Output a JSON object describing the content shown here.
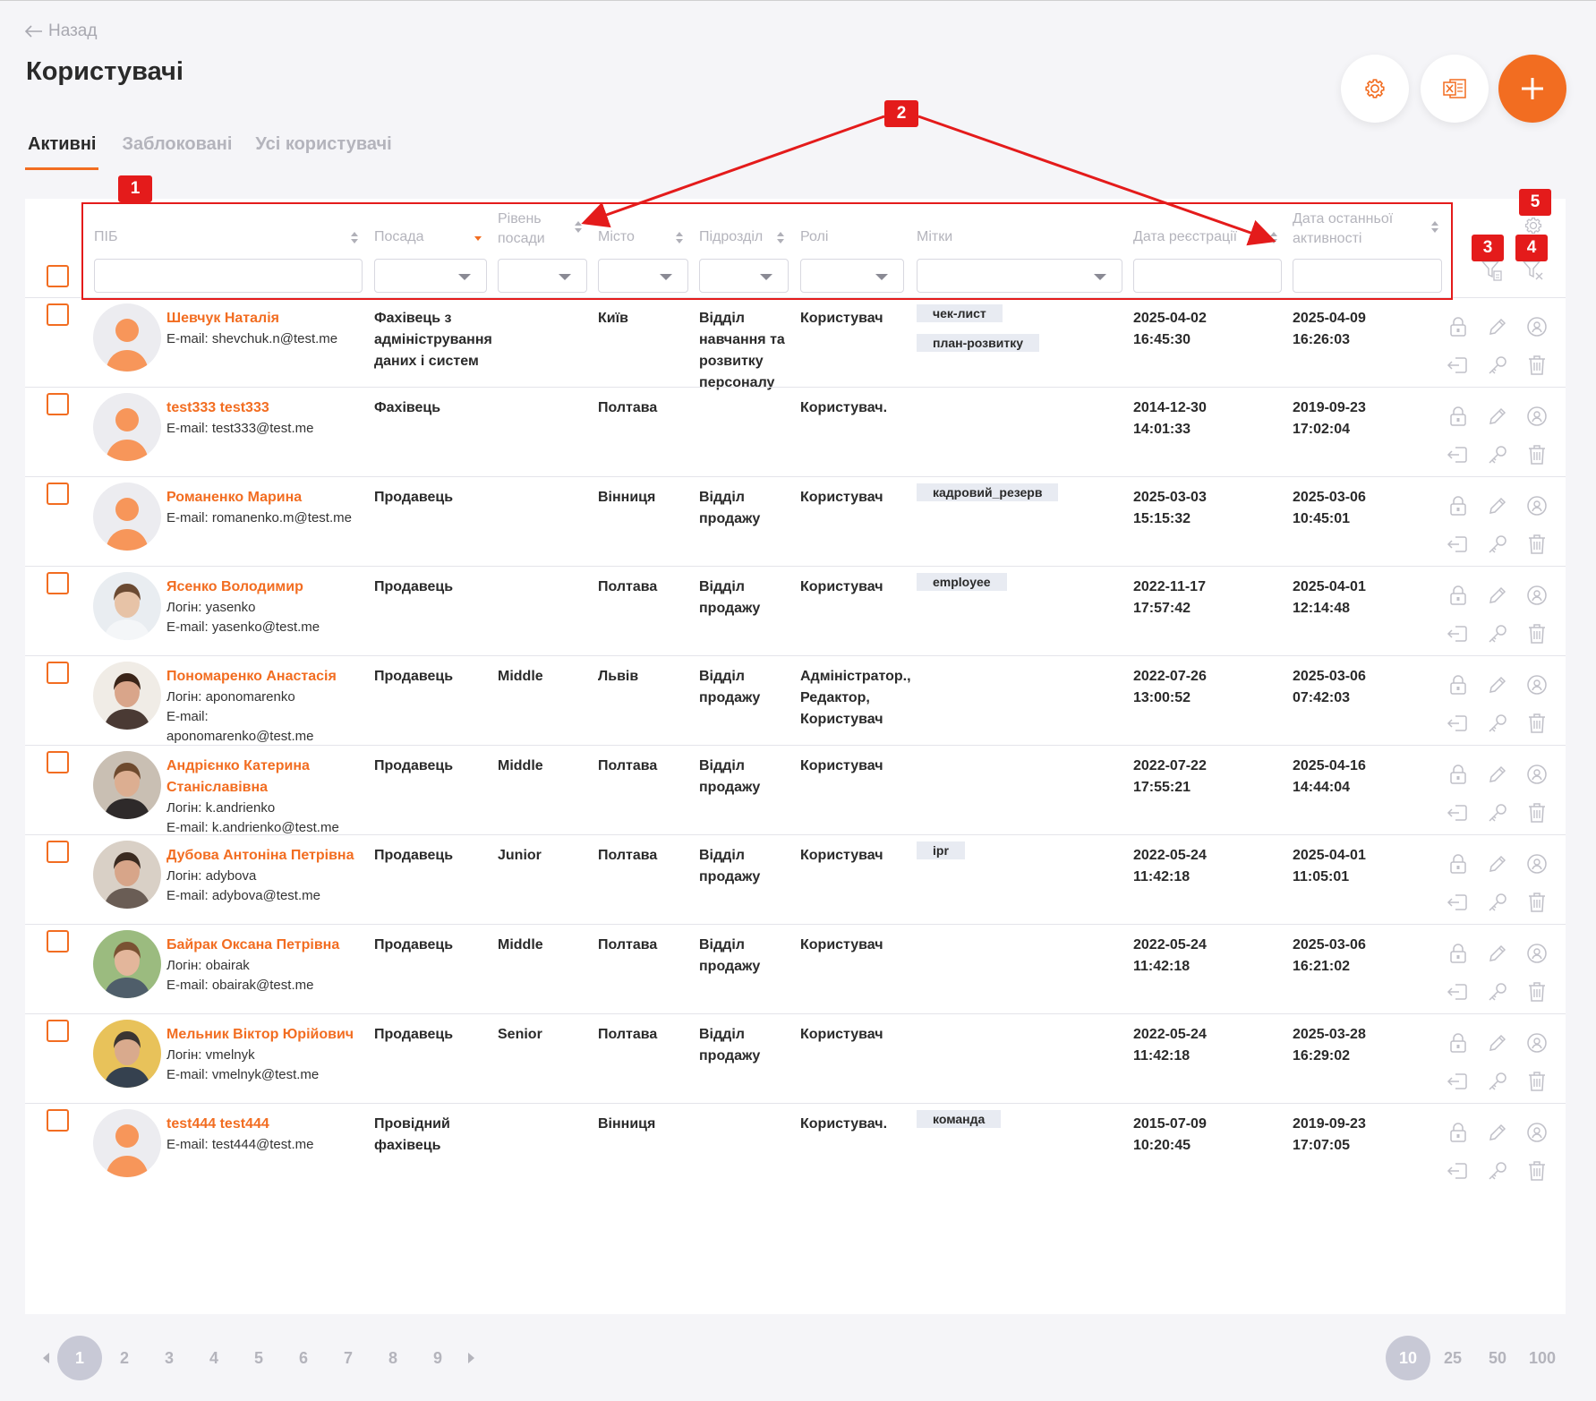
{
  "back_label": "Назад",
  "page_title": "Користувачі",
  "tabs": [
    "Активні",
    "Заблоковані",
    "Усі користувачі"
  ],
  "columns": {
    "name": "ПІБ",
    "position": "Посада",
    "level": "Рівень посади",
    "city": "Місто",
    "department": "Підрозділ",
    "roles": "Ролі",
    "tags": "Мітки",
    "reg_date": "Дата реєстрації",
    "last_active": "Дата останньої активності"
  },
  "annotations": [
    "1",
    "2",
    "3",
    "4",
    "5"
  ],
  "rows": [
    {
      "name": "Шевчук Наталія",
      "login": "",
      "email": "E-mail: shevchuk.n@test.me",
      "position": "Фахівець з адміністрування даних і систем",
      "level": "",
      "city": "Київ",
      "department": "Відділ навчання та розвитку персоналу",
      "roles": "Користувач",
      "tags": [
        "чек-лист",
        "план-розвитку"
      ],
      "reg": [
        "2025-04-02",
        "16:45:30"
      ],
      "last": [
        "2025-04-09",
        "16:26:03"
      ],
      "avatar": "placeholder"
    },
    {
      "name": "test333 test333",
      "login": "",
      "email": "E-mail: test333@test.me",
      "position": "Фахівець",
      "level": "",
      "city": "Полтава",
      "department": "",
      "roles": "Користувач.",
      "tags": [],
      "reg": [
        "2014-12-30",
        "14:01:33"
      ],
      "last": [
        "2019-09-23",
        "17:02:04"
      ],
      "avatar": "placeholder"
    },
    {
      "name": "Романенко Марина",
      "login": "",
      "email": "E-mail: romanenko.m@test.me",
      "position": "Продавець",
      "level": "",
      "city": "Вінниця",
      "department": "Відділ продажу",
      "roles": "Користувач",
      "tags": [
        "кадровий_резерв"
      ],
      "reg": [
        "2025-03-03",
        "15:15:32"
      ],
      "last": [
        "2025-03-06",
        "10:45:01"
      ],
      "avatar": "placeholder"
    },
    {
      "name": "Ясенко Володимир",
      "login": "Логін: yasenko",
      "email": "E-mail: yasenko@test.me",
      "position": "Продавець",
      "level": "",
      "city": "Полтава",
      "department": "Відділ продажу",
      "roles": "Користувач",
      "tags": [
        "employee"
      ],
      "reg": [
        "2022-11-17",
        "17:57:42"
      ],
      "last": [
        "2025-04-01",
        "12:14:48"
      ],
      "avatar": "photo1"
    },
    {
      "name": "Пономаренко Анастасія",
      "login": "Логін: aponomarenko",
      "email": "E-mail: aponomarenko@test.me",
      "position": "Продавець",
      "level": "Middle",
      "city": "Львів",
      "department": "Відділ продажу",
      "roles": "Адміністратор., Редактор, Користувач",
      "tags": [],
      "reg": [
        "2022-07-26",
        "13:00:52"
      ],
      "last": [
        "2025-03-06",
        "07:42:03"
      ],
      "avatar": "photo2"
    },
    {
      "name": "Андрієнко Катерина Станіславівна",
      "login": "Логін: k.andrienko",
      "email": "E-mail: k.andrienko@test.me",
      "position": "Продавець",
      "level": "Middle",
      "city": "Полтава",
      "department": "Відділ продажу",
      "roles": "Користувач",
      "tags": [],
      "reg": [
        "2022-07-22",
        "17:55:21"
      ],
      "last": [
        "2025-04-16",
        "14:44:04"
      ],
      "avatar": "photo3"
    },
    {
      "name": "Дубова Антоніна Петрівна",
      "login": "Логін: adybova",
      "email": "E-mail: adybova@test.me",
      "position": "Продавець",
      "level": "Junior",
      "city": "Полтава",
      "department": "Відділ продажу",
      "roles": "Користувач",
      "tags": [
        "ipr"
      ],
      "reg": [
        "2022-05-24",
        "11:42:18"
      ],
      "last": [
        "2025-04-01",
        "11:05:01"
      ],
      "avatar": "photo4"
    },
    {
      "name": "Байрак Оксана Петрівна",
      "login": "Логін: obairak",
      "email": "E-mail: obairak@test.me",
      "position": "Продавець",
      "level": "Middle",
      "city": "Полтава",
      "department": "Відділ продажу",
      "roles": "Користувач",
      "tags": [],
      "reg": [
        "2022-05-24",
        "11:42:18"
      ],
      "last": [
        "2025-03-06",
        "16:21:02"
      ],
      "avatar": "photo5"
    },
    {
      "name": "Мельник Віктор Юрійович",
      "login": "Логін: vmelnyk",
      "email": "E-mail: vmelnyk@test.me",
      "position": "Продавець",
      "level": "Senior",
      "city": "Полтава",
      "department": "Відділ продажу",
      "roles": "Користувач",
      "tags": [],
      "reg": [
        "2022-05-24",
        "11:42:18"
      ],
      "last": [
        "2025-03-28",
        "16:29:02"
      ],
      "avatar": "photo6"
    },
    {
      "name": "test444 test444",
      "login": "",
      "email": "E-mail: test444@test.me",
      "position": "Провідний фахівець",
      "level": "",
      "city": "Вінниця",
      "department": "",
      "roles": "Користувач.",
      "tags": [
        "команда"
      ],
      "reg": [
        "2015-07-09",
        "10:20:45"
      ],
      "last": [
        "2019-09-23",
        "17:07:05"
      ],
      "avatar": "placeholder"
    }
  ],
  "pagination": {
    "pages": [
      "1",
      "2",
      "3",
      "4",
      "5",
      "6",
      "7",
      "8",
      "9"
    ],
    "current": "1",
    "per_page": [
      "10",
      "25",
      "50",
      "100"
    ],
    "per_page_selected": "10"
  },
  "colors": {
    "accent": "#f26d21",
    "annotation": "#e41b1b",
    "muted": "#b4b4bc"
  }
}
